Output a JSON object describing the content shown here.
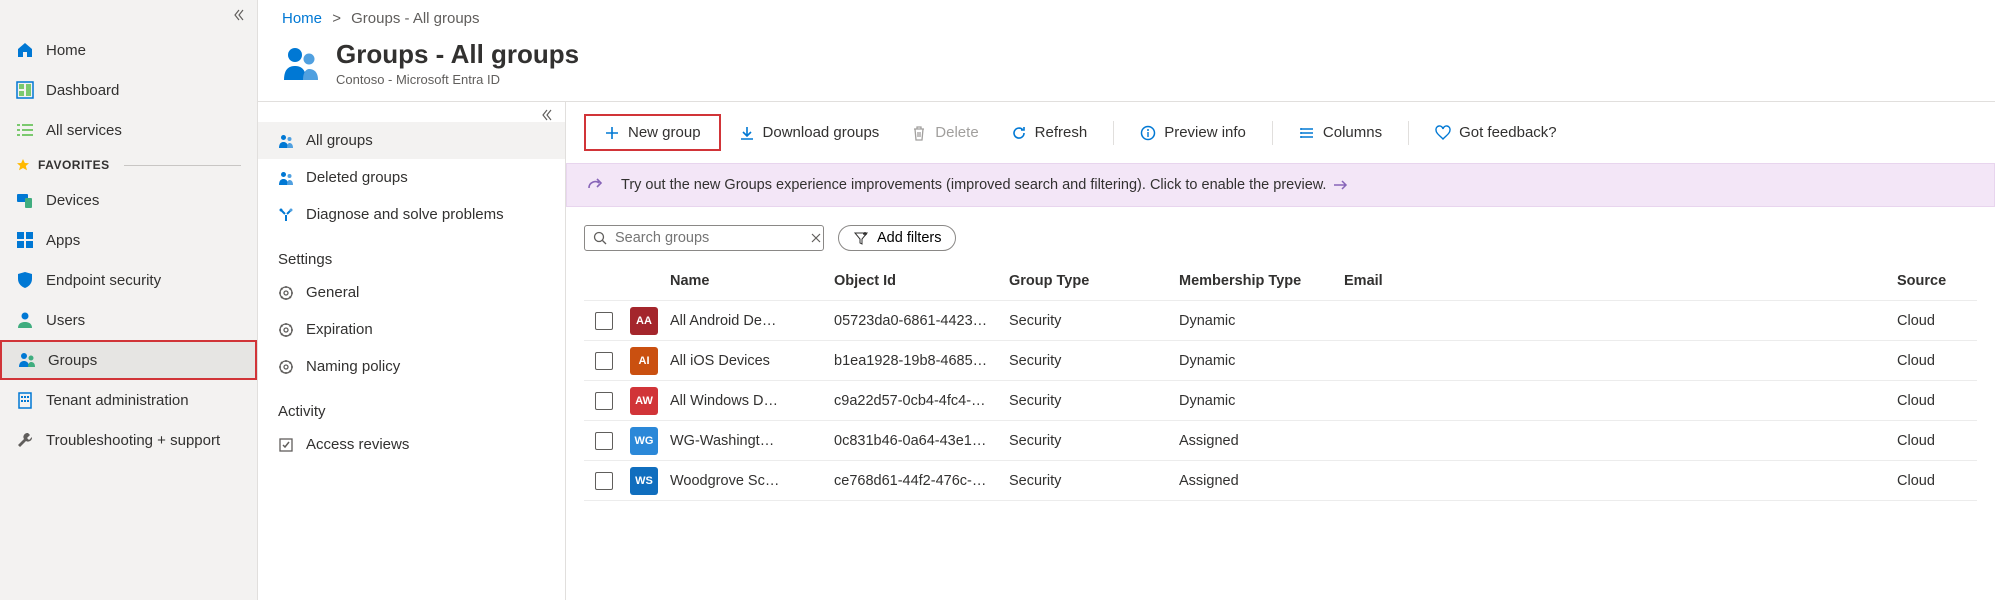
{
  "breadcrumb": {
    "home": "Home",
    "separator": ">",
    "current": "Groups - All groups"
  },
  "header": {
    "title": "Groups - All groups",
    "subtitle": "Contoso - Microsoft Entra ID"
  },
  "sidebar": {
    "items": [
      {
        "label": "Home"
      },
      {
        "label": "Dashboard"
      },
      {
        "label": "All services"
      }
    ],
    "favorites_label": "FAVORITES",
    "favorites": [
      {
        "label": "Devices"
      },
      {
        "label": "Apps"
      },
      {
        "label": "Endpoint security"
      },
      {
        "label": "Users"
      },
      {
        "label": "Groups"
      },
      {
        "label": "Tenant administration"
      },
      {
        "label": "Troubleshooting + support"
      }
    ]
  },
  "midnav": {
    "top": [
      {
        "label": "All groups"
      },
      {
        "label": "Deleted groups"
      },
      {
        "label": "Diagnose and solve problems"
      }
    ],
    "settings_label": "Settings",
    "settings": [
      {
        "label": "General"
      },
      {
        "label": "Expiration"
      },
      {
        "label": "Naming policy"
      }
    ],
    "activity_label": "Activity",
    "activity": [
      {
        "label": "Access reviews"
      }
    ]
  },
  "toolbar": {
    "new_group": "New group",
    "download": "Download groups",
    "delete": "Delete",
    "refresh": "Refresh",
    "preview_info": "Preview info",
    "columns": "Columns",
    "feedback": "Got feedback?"
  },
  "banner": {
    "text": "Try out the new Groups experience improvements (improved search and filtering). Click to enable the preview."
  },
  "search": {
    "placeholder": "Search groups"
  },
  "filters": {
    "add_filters": "Add filters"
  },
  "table": {
    "headers": {
      "name": "Name",
      "object_id": "Object Id",
      "group_type": "Group Type",
      "membership_type": "Membership Type",
      "email": "Email",
      "source": "Source"
    },
    "rows": [
      {
        "initials": "AA",
        "color": "#a4262c",
        "name": "All Android De…",
        "object_id": "05723da0-6861-4423…",
        "group_type": "Security",
        "membership_type": "Dynamic",
        "email": "",
        "source": "Cloud"
      },
      {
        "initials": "AI",
        "color": "#ca5010",
        "name": "All iOS Devices",
        "object_id": "b1ea1928-19b8-4685…",
        "group_type": "Security",
        "membership_type": "Dynamic",
        "email": "",
        "source": "Cloud"
      },
      {
        "initials": "AW",
        "color": "#d13438",
        "name": "All Windows D…",
        "object_id": "c9a22d57-0cb4-4fc4-…",
        "group_type": "Security",
        "membership_type": "Dynamic",
        "email": "",
        "source": "Cloud"
      },
      {
        "initials": "WG",
        "color": "#2b88d8",
        "name": "WG-Washingt…",
        "object_id": "0c831b46-0a64-43e1…",
        "group_type": "Security",
        "membership_type": "Assigned",
        "email": "",
        "source": "Cloud"
      },
      {
        "initials": "WS",
        "color": "#106ebe",
        "name": "Woodgrove Sc…",
        "object_id": "ce768d61-44f2-476c-…",
        "group_type": "Security",
        "membership_type": "Assigned",
        "email": "",
        "source": "Cloud"
      }
    ]
  }
}
